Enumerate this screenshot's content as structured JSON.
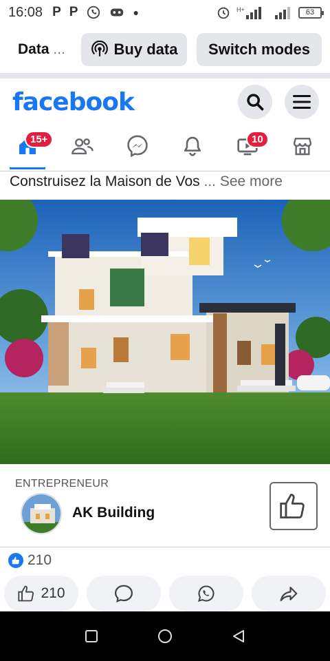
{
  "status_bar": {
    "time": "16:08",
    "left_icons": [
      "p-app-icon",
      "p-app-icon",
      "whatsapp-icon",
      "game-icon",
      "dot-icon"
    ],
    "network": "H+",
    "battery": "63"
  },
  "data_bar": {
    "label": "Data",
    "ellipsis": "...",
    "buy_data_label": "Buy data",
    "switch_modes_label": "Switch modes"
  },
  "header": {
    "logo": "facebook",
    "brand_color": "#1877f2"
  },
  "nav": {
    "home_badge": "15+",
    "watch_badge": "10"
  },
  "post": {
    "caption": "Construisez la Maison de Vos",
    "caption_ellipsis": "...",
    "see_more": "See more",
    "sponsor_category": "ENTREPRENEUR",
    "sponsor_name": "AK Building",
    "reaction_count": "210",
    "like_count": "210"
  }
}
